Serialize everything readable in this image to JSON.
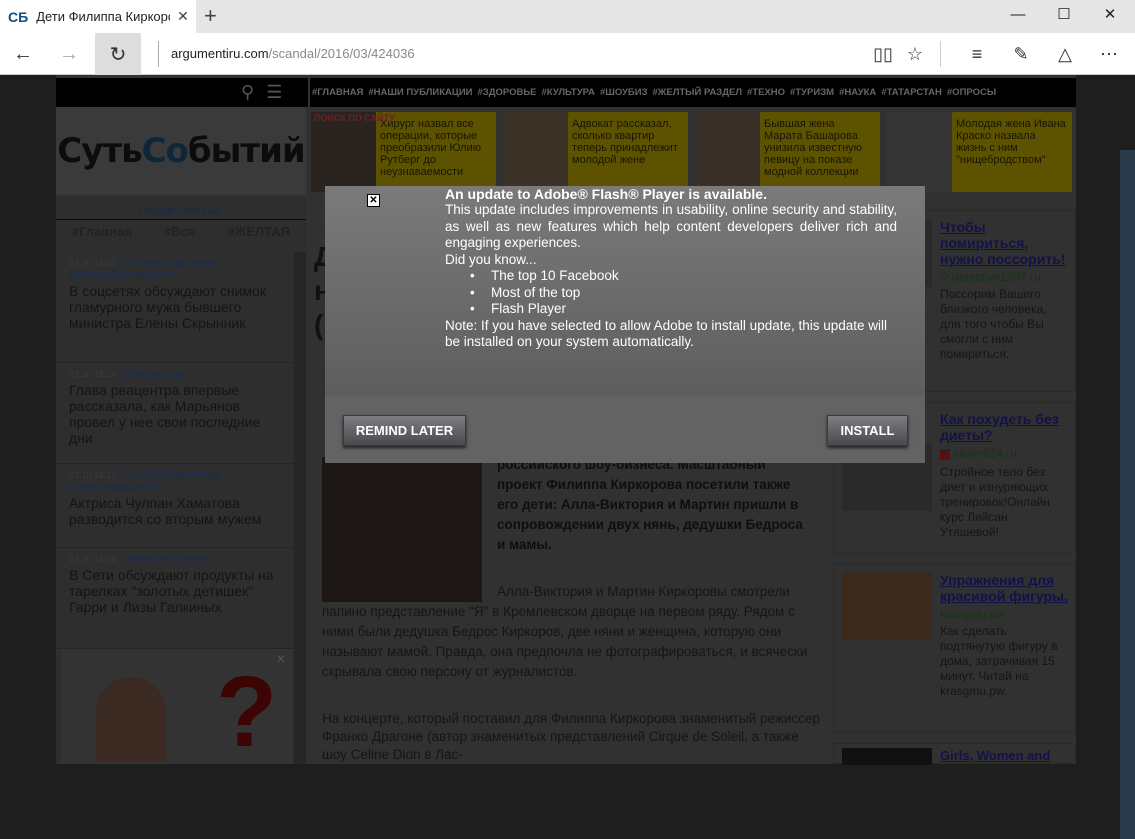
{
  "browser": {
    "tab_favicon": "СБ",
    "tab_title": "Дети Филиппа Киркоров",
    "url_domain": "argumentiru.com",
    "url_path": "/scandal/2016/03/424036"
  },
  "site": {
    "nav_links": [
      "#ГЛАВНАЯ",
      "#НАШИ ПУБЛИКАЦИИ",
      "#ЗДОРОВЬЕ",
      "#КУЛЬТУРА",
      "#ШОУБИЗ",
      "#ЖЕЛТЫЙ РАЗДЕЛ",
      "#ТЕХНО",
      "#ТУРИЗМ",
      "#НАУКА",
      "#ТАТАРСТАН",
      "#ОПРОСЫ"
    ],
    "logo_a": "Суть ",
    "logo_b": "Со",
    "logo_c": "бытий",
    "search_label": "ПОИСК ПО САЙТУ",
    "headlines": [
      "Хирург назвал все операции, которые преобразили Юлию Рутберг до неузнаваемости",
      "Адвокат рассказал, сколько квартир теперь принадлежит молодой жене",
      "Бывшая жена Марата Башарова унизила известную певицу на показе модной коллекции",
      "Молодая жена Ивана Краско назвала жизнь с ним \"нищебродством\""
    ],
    "sidebar": {
      "title": "Наши ленты:",
      "feeds": [
        "#Главная",
        "#Вся",
        "#ЖЕЛТАЯ"
      ],
      "items": [
        {
          "time": "23.10 18:41",
          "tags": "# ЕленаСкрынник , ДмитрийБелоносов",
          "title": "В соцсетях обсуждают снимок гламурного мужа бывшего министра Елены Скрынник"
        },
        {
          "time": "23.10 18:26",
          "tags": "# Марьянов",
          "title": "Глава реацентра впервые рассказала, как Марьянов провел у нее свои последние дни"
        },
        {
          "time": "23.10 18:11",
          "tags": "# ЧулпанХаматова , АлександрШейн",
          "title": "Актриса Чулпан Хаматова разводится со вторым мужем"
        },
        {
          "time": "23.10 15:25",
          "tags": "# МаксимГалкин",
          "title": "В Сети обсуждают продукты на тарелках \"золотых детишек\" Гарри и Лизы Галкиных"
        }
      ]
    },
    "article": {
      "heading": "Д\nн\n(",
      "lead": "российского шоу-бизнеса. Масштабный проект Филиппа Киркорова посетили также его дети: Алла-Виктория и Мартин пришли в сопровождении двух нянь, дедушки Бедроса и мамы.",
      "p1": "Алла-Виктория и Мартин Киркоровы смотрели папино представление \"Я\" в Кремлевском дворце на первом ряду. Рядом с ними были дедушка Бедрос Киркоров, две няни и женщина, которую они называют мамой. Правда, она предпочла не фотографироваться, и всячески скрывала свою персону от журналистов.",
      "p2": "На концерте, который поставил для Филиппа Киркорова знаменитый режиссер Франко Драгоне (автор знаменитых представлений Cirque de Soleil, а также шоу Celine Dion в Лас-"
    },
    "ads": [
      {
        "title": "Чтобы помириться, нужно поссорить!",
        "source": "detective1997.ru",
        "desc": "Поссорим Вашего близкого человека, для того чтобы Вы смогли с ним помириться."
      },
      {
        "title": "Как похудеть без диеты?",
        "source": "silavoli24.ru",
        "desc": "Стройное тело без диет и изнуряющих тренировок!Онлайн курс Ляйсан Утяшевой!"
      },
      {
        "title": "Упражнения для красивой фигуры.",
        "source": "krasgmu.pw",
        "desc": "Как сделать подтянутую фигуру в дома, затрачивая 15 минут. Читай на krasgmu.pw."
      },
      {
        "title": "Girls, Women and",
        "source": "",
        "desc": ""
      }
    ]
  },
  "modal": {
    "close": "✕",
    "title": "An update to Adobe® Flash® Player is available.",
    "body": "This update includes improvements in usability, online security and stability, as well as new features which help content developers deliver rich and engaging experiences.",
    "did_you_know": "Did you know...",
    "bullets": [
      "The top 10 Facebook",
      "Most of the top",
      "Flash Player"
    ],
    "note": "Note: If you have selected to allow Adobe to install update, this update will be installed on your system automatically.",
    "remind_label": "REMIND LATER",
    "install_label": "INSTALL"
  }
}
